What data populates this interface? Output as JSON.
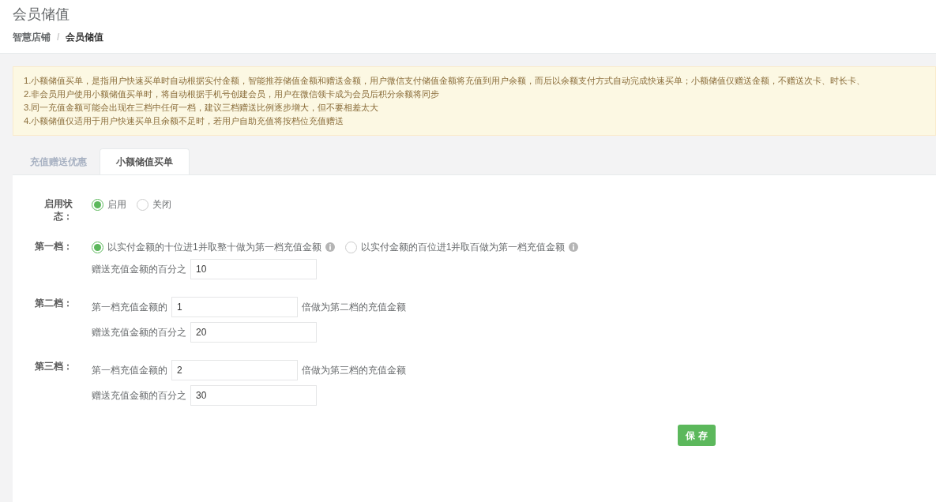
{
  "page_title": "会员储值",
  "breadcrumb_separator": "/",
  "breadcrumb": [
    {
      "label": "智慧店铺",
      "current": false
    },
    {
      "label": "会员储值",
      "current": true
    }
  ],
  "notice": [
    "1.小额储值买单，是指用户快速买单时自动根据实付金额，智能推荐储值金额和赠送金额，用户微信支付储值金额将充值到用户余额，而后以余额支付方式自动完成快速买单；小额储值仅赠送金额，不赠送次卡、时长卡、",
    "2.非会员用户使用小额储值买单时，将自动根据手机号创建会员，用户在微信领卡成为会员后积分余额将同步",
    "3.同一充值金额可能会出现在三档中任何一档，建议三档赠送比例逐步增大，但不要相差太大",
    "4.小额储值仅适用于用户快速买单且余额不足时，若用户自助充值将按档位充值赠送"
  ],
  "tabs": [
    {
      "label": "充值赠送优惠",
      "selected": false
    },
    {
      "label": "小额储值买单",
      "selected": true
    }
  ],
  "form": [
    {
      "kind": "choice",
      "label": "启用状态：",
      "options": [
        {
          "label": "启用",
          "selected": true,
          "info": false
        },
        {
          "label": "关闭",
          "selected": false,
          "info": false
        }
      ]
    },
    {
      "kind": "choice",
      "label": "第一档：",
      "options": [
        {
          "label": "以实付金额的十位进1并取整十做为第一档充值金额",
          "selected": true,
          "info": true
        },
        {
          "label": "以实付金额的百位进1并取百做为第一档充值金额",
          "selected": false,
          "info": true
        }
      ],
      "gift_label": "赠送充值金额的百分之",
      "gift_value": "10"
    },
    {
      "kind": "multiplier",
      "label": "第二档：",
      "prefix": "第一档充值金额的",
      "value": "1",
      "suffix": "倍做为第二档的充值金额",
      "gift_label": "赠送充值金额的百分之",
      "gift_value": "20"
    },
    {
      "kind": "multiplier",
      "label": "第三档：",
      "prefix": "第一档充值金额的",
      "value": "2",
      "suffix": "倍做为第三档的充值金额",
      "gift_label": "赠送充值金额的百分之",
      "gift_value": "30"
    }
  ],
  "save_button": "保 存"
}
